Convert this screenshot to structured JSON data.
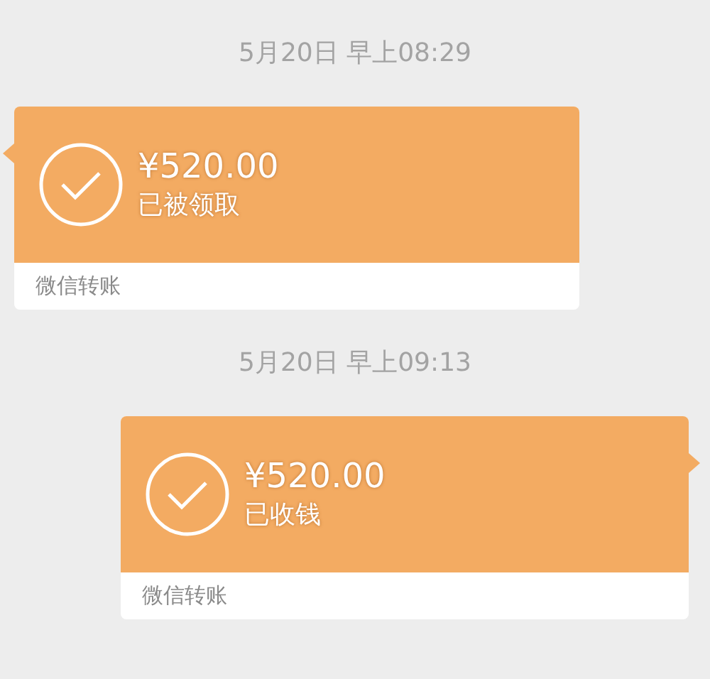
{
  "messages": [
    {
      "kind": "timestamp",
      "text": "5月20日 早上08:29"
    },
    {
      "kind": "transfer",
      "incoming": true,
      "amount": "¥520.00",
      "status": "已被领取",
      "footer": "微信转账"
    },
    {
      "kind": "timestamp",
      "text": "5月20日 早上09:13"
    },
    {
      "kind": "transfer",
      "incoming": false,
      "amount": "¥520.00",
      "status": "已收钱",
      "footer": "微信转账"
    }
  ]
}
